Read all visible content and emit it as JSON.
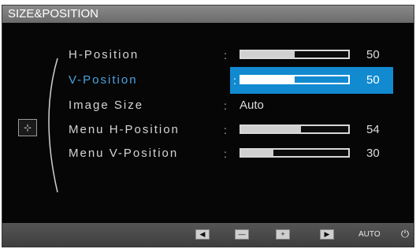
{
  "title": "SIZE&POSITION",
  "rows": [
    {
      "label": "H-Position",
      "value": "50",
      "level": 0.5,
      "selected": false
    },
    {
      "label": "V-Position",
      "value": "50",
      "level": 0.5,
      "selected": true
    },
    {
      "label": "Image Size",
      "value": "Auto",
      "selected": false
    },
    {
      "label": "Menu H-Position",
      "value": "54",
      "level": 0.56,
      "selected": false
    },
    {
      "label": "Menu V-Position",
      "value": "30",
      "level": 0.3,
      "selected": false
    }
  ],
  "footer": {
    "left_icon": "left-arrow-icon",
    "minus_icon": "minus-icon",
    "plus_icon": "plus-icon",
    "enter_icon": "enter-icon",
    "auto_label": "AUTO",
    "power_icon": "power-icon"
  },
  "colors": {
    "highlight": "#118ad0",
    "selected_text": "#4aa3df"
  }
}
